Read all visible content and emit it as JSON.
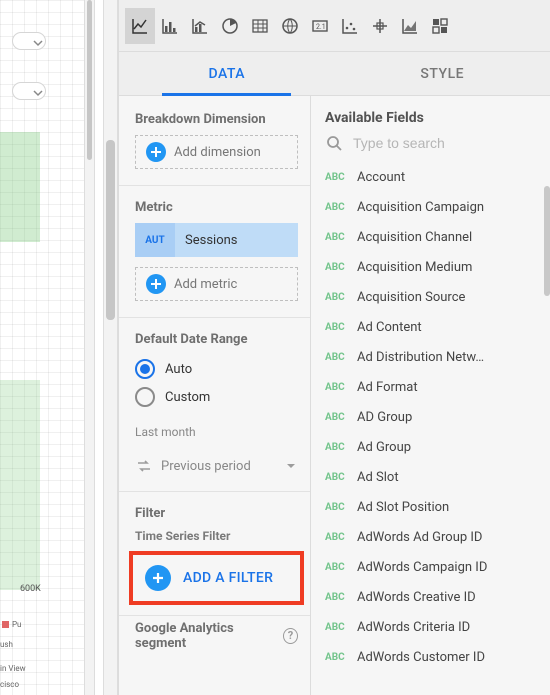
{
  "canvas": {
    "y_label": "600K",
    "legend_text": "Pu",
    "tags": [
      "ush",
      "in View",
      "cisco"
    ]
  },
  "chart_icons": [
    "line-chart-icon",
    "bar-chart-icon",
    "combo-chart-icon",
    "pie-chart-icon",
    "table-icon",
    "geo-icon",
    "scorecard-icon",
    "scatter-icon",
    "bullet-icon",
    "area-chart-icon",
    "pivot-icon"
  ],
  "tabs": {
    "data": "DATA",
    "style": "STYLE"
  },
  "breakdown": {
    "title": "Breakdown Dimension",
    "add_label": "Add dimension"
  },
  "metric": {
    "title": "Metric",
    "type": "AUT",
    "label": "Sessions",
    "add_label": "Add metric"
  },
  "date_range": {
    "title": "Default Date Range",
    "auto": "Auto",
    "custom": "Custom",
    "note": "Last month",
    "compare": "Previous period"
  },
  "filter": {
    "title": "Filter",
    "sub": "Time Series Filter",
    "button": "ADD A FILTER"
  },
  "segment": {
    "label": "Google Analytics segment"
  },
  "fields": {
    "title": "Available Fields",
    "placeholder": "Type to search",
    "items": [
      "Account",
      "Acquisition Campaign",
      "Acquisition Channel",
      "Acquisition Medium",
      "Acquisition Source",
      "Ad Content",
      "Ad Distribution Netw…",
      "Ad Format",
      "AD Group",
      "Ad Group",
      "Ad Slot",
      "Ad Slot Position",
      "AdWords Ad Group ID",
      "AdWords Campaign ID",
      "AdWords Creative ID",
      "AdWords Criteria ID",
      "AdWords Customer ID"
    ],
    "type_label": "ABC"
  }
}
